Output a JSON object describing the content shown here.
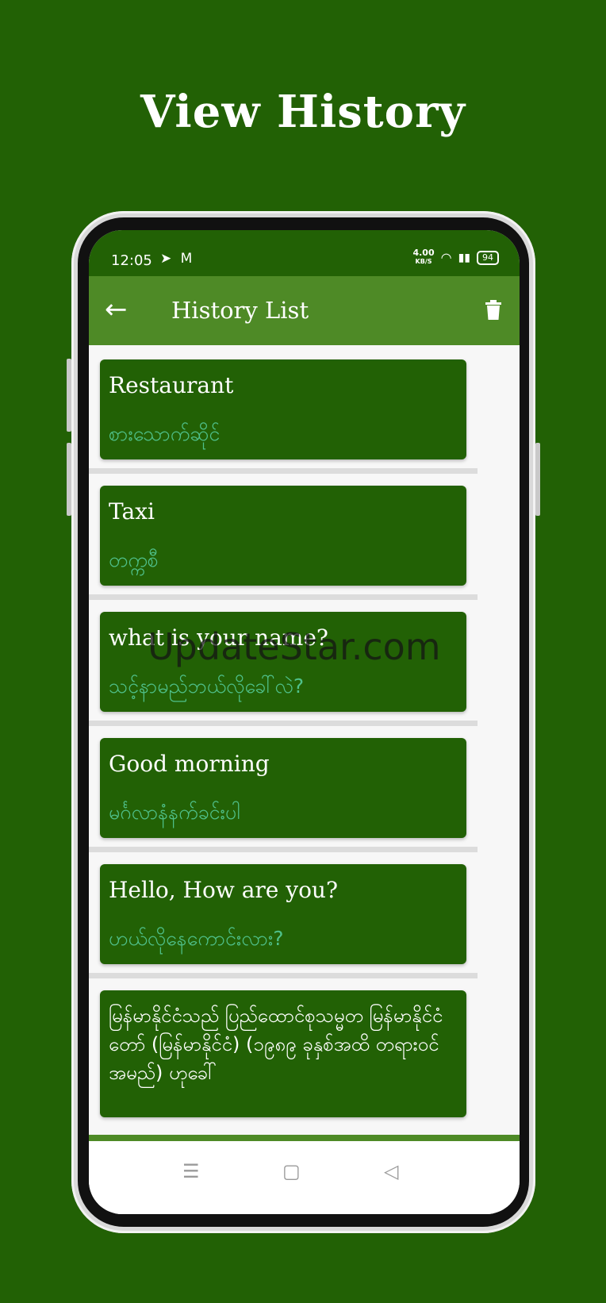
{
  "promo": {
    "title": "View History"
  },
  "status_bar": {
    "time": "12:05",
    "left_icons": [
      "telegram-icon",
      "gmail-icon"
    ],
    "net_speed_value": "4.00",
    "net_speed_unit": "KB/S",
    "battery": "94"
  },
  "app_bar": {
    "title": "History List",
    "back_icon": "arrow-left-icon",
    "delete_icon": "trash-icon"
  },
  "history": [
    {
      "source": "Restaurant",
      "translation": "စားသောက်ဆိုင်"
    },
    {
      "source": "Taxi",
      "translation": "တက္ကစီ"
    },
    {
      "source": "what is your name?",
      "translation": "သင့်နာမည်ဘယ်လိုခေါ်လဲ?"
    },
    {
      "source": "Good morning",
      "translation": "မင်္ဂလာနံနက်ခင်းပါ"
    },
    {
      "source": "Hello, How are you?",
      "translation": "ဟယ်လိုနေကောင်းလား?"
    },
    {
      "source": "မြန်မာနိုင်ငံသည် ပြည်ထောင်စုသမ္မတ မြန်မာနိုင်ငံတော် (မြန်မာနိုင်ငံ) (၁၉၈၉ ခုနှစ်အထိ တရားဝင်အမည်) ဟုခေါ်"
    }
  ],
  "nav_bar": {
    "menu_icon": "☰",
    "home_icon": "▢",
    "back_icon": "◁"
  },
  "watermark": "UpdateStar.com",
  "colors": {
    "background": "#226105",
    "app_bar": "#4e8a26",
    "card": "#226105",
    "translation_text": "#4fc08a"
  }
}
